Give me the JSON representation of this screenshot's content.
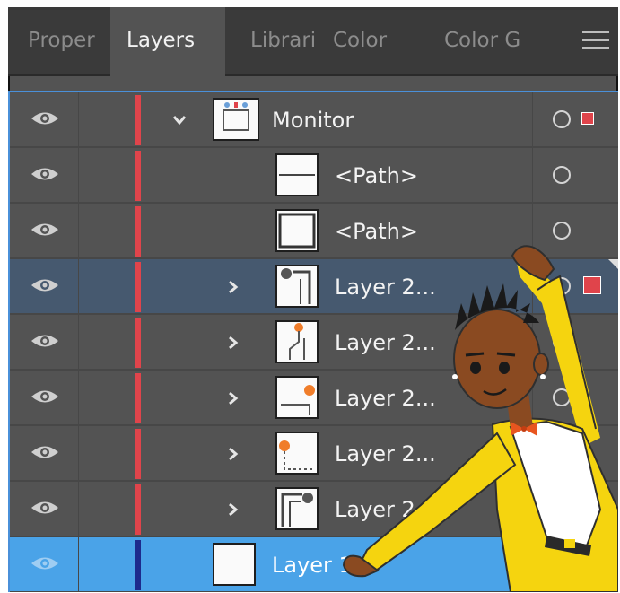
{
  "tabs": [
    {
      "label": "Proper",
      "active": false
    },
    {
      "label": "Layers",
      "active": true
    },
    {
      "label": "Librari",
      "active": false
    },
    {
      "label": "Color",
      "active": false
    },
    {
      "label": "Color G",
      "active": false
    }
  ],
  "menu_icon": "hamburger-menu-icon",
  "layers": [
    {
      "name": "Monitor",
      "visible": true,
      "expanded": true,
      "target_selected": true
    },
    {
      "name": "<Path>",
      "visible": true
    },
    {
      "name": "<Path>",
      "visible": true
    },
    {
      "name": "Layer 2...",
      "visible": true,
      "expanded": false,
      "target_selected": true,
      "highlighted": true
    },
    {
      "name": "Layer 2...",
      "visible": true,
      "expanded": false
    },
    {
      "name": "Layer 2...",
      "visible": true,
      "expanded": false
    },
    {
      "name": "Layer 2...",
      "visible": true,
      "expanded": false
    },
    {
      "name": "Layer 2",
      "visible": true,
      "expanded": false
    },
    {
      "name": "Layer 1",
      "visible": true,
      "selected": true
    }
  ],
  "colors": {
    "layer_color": "#e0444b",
    "selected_layer_color": "#1d2a8c",
    "selection_blue": "#4aa3e8",
    "highlight_row": "#46596f"
  }
}
